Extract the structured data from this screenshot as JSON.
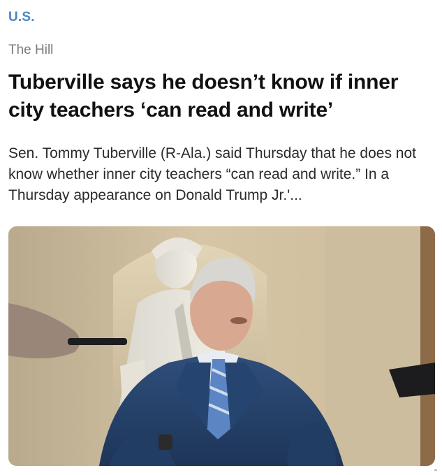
{
  "section": "U.S.",
  "source": "The Hill",
  "headline": "Tuberville says he doesn’t know if inner city teachers ‘can read and write’",
  "summary": "Sen. Tommy Tuberville (R-Ala.) said Thursday that he does not know whether inner city teachers “can read and write.” In a Thursday appearance on Donald Trump Jr.'...",
  "colors": {
    "section": "#4a86c6",
    "source": "#7b7b80",
    "headline": "#111111",
    "summary": "#2a2a2a"
  },
  "photo": {
    "icon": "news-photo"
  }
}
